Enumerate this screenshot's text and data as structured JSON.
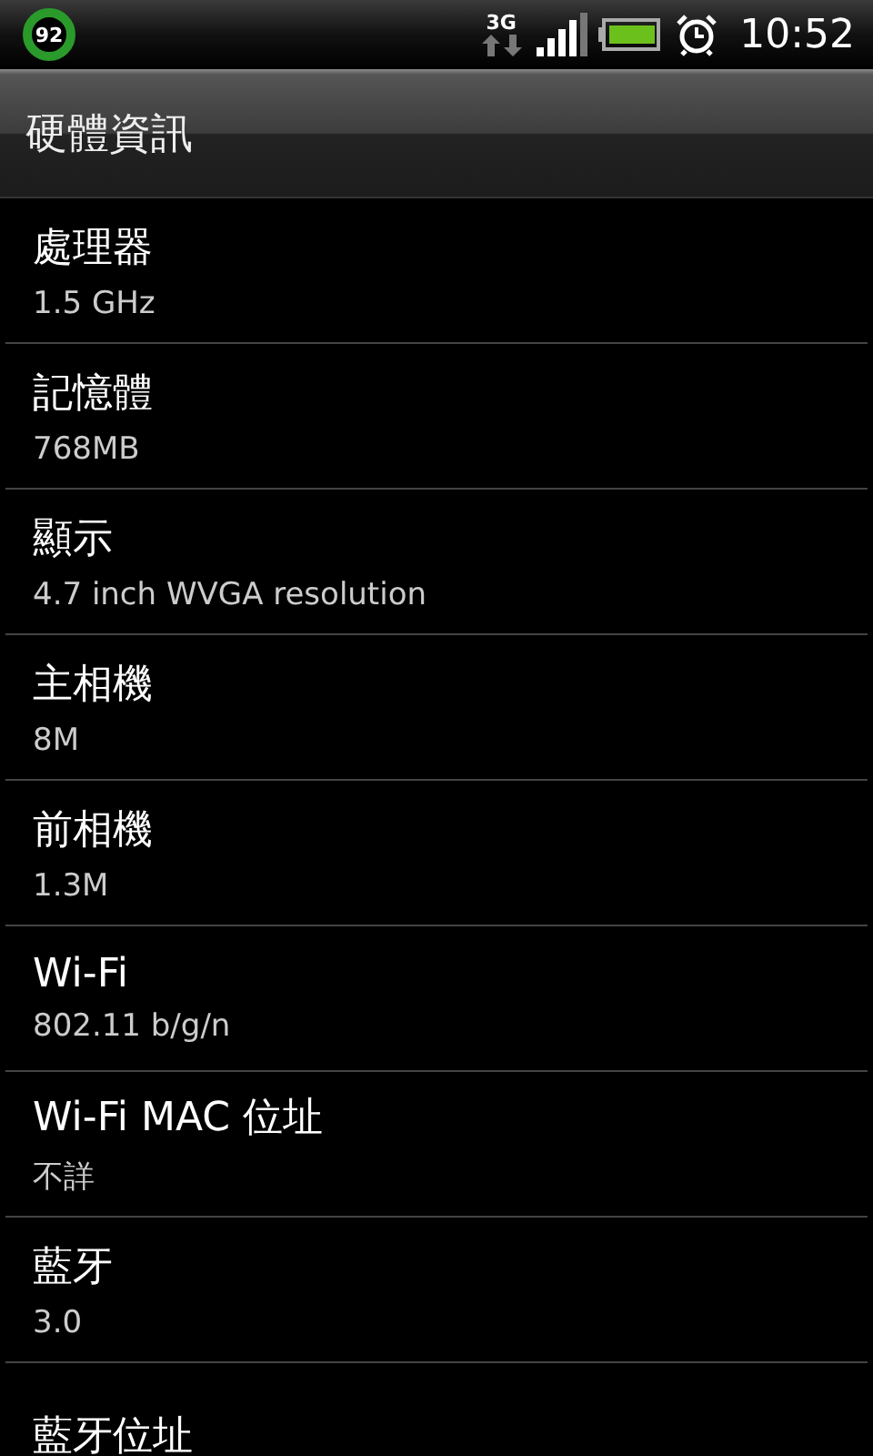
{
  "status_bar": {
    "badge": "92",
    "network": "3G",
    "time": "10:52"
  },
  "header": {
    "title": "硬體資訊"
  },
  "items": [
    {
      "title": "處理器",
      "value": "1.5 GHz"
    },
    {
      "title": "記憶體",
      "value": "768MB"
    },
    {
      "title": "顯示",
      "value": "4.7 inch WVGA resolution"
    },
    {
      "title": "主相機",
      "value": "8M"
    },
    {
      "title": "前相機",
      "value": "1.3M"
    },
    {
      "title": "Wi-Fi",
      "value": "802.11 b/g/n"
    },
    {
      "title": "Wi-Fi MAC 位址",
      "value": "不詳"
    },
    {
      "title": "藍牙",
      "value": "3.0"
    },
    {
      "title": "藍牙位址"
    }
  ]
}
